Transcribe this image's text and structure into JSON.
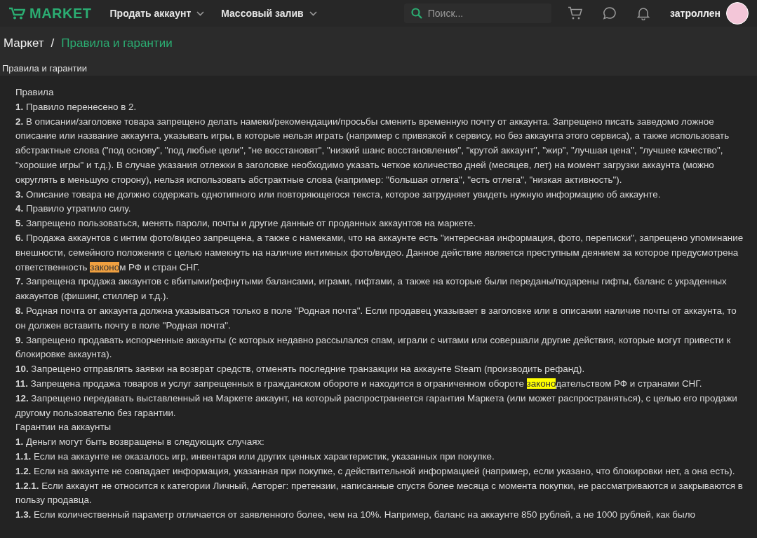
{
  "header": {
    "logo": "MARKET",
    "nav": [
      {
        "label": "Продать аккаунт"
      },
      {
        "label": "Массовый залив"
      }
    ],
    "search": {
      "placeholder": "Поиск..."
    },
    "username": "затроллен"
  },
  "breadcrumbs": [
    {
      "label": "Маркет",
      "selected": false
    },
    {
      "label": "Правила и гарантии",
      "selected": true
    }
  ],
  "breadcrumb_separator": "/",
  "page_title": "Правила и гарантии",
  "paragraphs": [
    {
      "kind": "heading",
      "segments": [
        {
          "text": "Правила",
          "highlighted": false
        }
      ]
    },
    {
      "kind": "item",
      "num": "1.",
      "segments": [
        {
          "text": "Правило перенесено в 2.",
          "highlighted": false
        }
      ]
    },
    {
      "kind": "item",
      "num": "2.",
      "segments": [
        {
          "text": "В описании/заголовке товара запрещено делать намеки/рекомендации/просьбы сменить временную почту от аккаунта. Запрещено писать заведомо ложное описание или название аккаунта, указывать игры, в которые нельзя играть (например с привязкой к сервису, но без аккаунта этого сервиса), а также использовать абстрактные слова (\"под основу\", \"под любые цели\", \"не восстановят\", \"низкий шанс восстановления\", \"крутой аккаунт\", \"жир\", \"лучшая цена\", \"лучшее качество\", \"хорошие игры\" и т.д.). В случае указания отлежки в заголовке необходимо указать четкое количество дней (месяцев, лет) на момент загрузки аккаунта (можно округлять в меньшую сторону), нельзя использовать абстрактные слова (например: \"большая отлега\", \"есть отлега\", \"низкая активность\").",
          "highlighted": false
        }
      ]
    },
    {
      "kind": "item",
      "num": "3.",
      "segments": [
        {
          "text": "Описание товара не должно содержать однотипного или повторяющегося текста, которое затрудняет увидеть нужную информацию об аккаунте.",
          "highlighted": false
        }
      ]
    },
    {
      "kind": "item",
      "num": "4.",
      "segments": [
        {
          "text": "Правило утратило силу.",
          "highlighted": false
        }
      ]
    },
    {
      "kind": "item",
      "num": "5.",
      "segments": [
        {
          "text": "Запрещено пользоваться, менять пароли, почты и другие данные от проданных аккаунтов на маркете.",
          "highlighted": false
        }
      ]
    },
    {
      "kind": "item",
      "num": "6.",
      "segments": [
        {
          "text": "Продажа аккаунтов с интим фото/видео запрещена, а также с намеками, что на аккаунте есть \"интересная информация, фото, переписки\", запрещено упоминание внешности, семейного положения с целью намекнуть на наличие интимных фото/видео. Данное действие является преступным деянием за которое предусмотрена ответственность ",
          "highlighted": false
        },
        {
          "text": "законо",
          "highlighted": true,
          "current": true
        },
        {
          "text": "м РФ и стран СНГ.",
          "highlighted": false
        }
      ]
    },
    {
      "kind": "item",
      "num": "7.",
      "segments": [
        {
          "text": "Запрещена продажа аккаунтов с вбитыми/рефнутыми балансами, играми, гифтами, а также на которые были переданы/подарены гифты, баланс с украденных аккаунтов (фишинг, стиллер и т.д.).",
          "highlighted": false
        }
      ]
    },
    {
      "kind": "item",
      "num": "8.",
      "segments": [
        {
          "text": "Родная почта от аккаунта должна указываться только в поле \"Родная почта\". Если продавец указывает в заголовке или в описании наличие почты от аккаунта, то он должен вставить почту в поле \"Родная почта\".",
          "highlighted": false
        }
      ]
    },
    {
      "kind": "item",
      "num": "9.",
      "segments": [
        {
          "text": "Запрещено продавать испорченные аккаунты (с которых недавно рассылался спам, играли с читами или совершали другие действия, которые могут привести к блокировке аккаунта).",
          "highlighted": false
        }
      ]
    },
    {
      "kind": "item",
      "num": "10.",
      "segments": [
        {
          "text": "Запрещено отправлять заявки на возврат средств, отменять последние транзакции на аккаунте Steam (производить рефанд).",
          "highlighted": false
        }
      ]
    },
    {
      "kind": "item",
      "num": "11.",
      "segments": [
        {
          "text": "Запрещена продажа товаров и услуг запрещенных в гражданском обороте и находится в ограниченном обороте ",
          "highlighted": false
        },
        {
          "text": "законо",
          "highlighted": true,
          "current": false
        },
        {
          "text": "дательством РФ и странами СНГ.",
          "highlighted": false
        }
      ]
    },
    {
      "kind": "item",
      "num": "12.",
      "segments": [
        {
          "text": "Запрещено передавать выставленный на Маркете аккаунт, на который распространяется гарантия Маркета (или может распространяться), с целью его продажи другому пользователю без гарантии.",
          "highlighted": false
        }
      ]
    },
    {
      "kind": "heading",
      "segments": [
        {
          "text": "Гарантии на аккаунты",
          "highlighted": false
        }
      ]
    },
    {
      "kind": "item",
      "num": "1.",
      "segments": [
        {
          "text": "Деньги могут быть возвращены в следующих случаях:",
          "highlighted": false
        }
      ]
    },
    {
      "kind": "item",
      "num": "1.1.",
      "segments": [
        {
          "text": "Если на аккаунте не оказалось игр, инвентаря или других ценных характеристик, указанных при покупке.",
          "highlighted": false
        }
      ]
    },
    {
      "kind": "item",
      "num": "1.2.",
      "segments": [
        {
          "text": "Если на аккаунте не совпадает информация, указанная при покупке, с действительной информацией (например, если указано, что блокировки нет, а она есть).",
          "highlighted": false
        }
      ]
    },
    {
      "kind": "item",
      "num": "1.2.1.",
      "segments": [
        {
          "text": "Если аккаунт не относится к категории Личный, Авторег: претензии, написанные спустя более месяца с момента покупки, не рассматриваются и закрываются в пользу продавца.",
          "highlighted": false
        }
      ]
    },
    {
      "kind": "item",
      "num": "1.3.",
      "segments": [
        {
          "text": "Если количественный параметр отличается от заявленного более, чем на 10%. Например, баланс на аккаунте 850 рублей, а не 1000 рублей, как было",
          "highlighted": false
        }
      ]
    }
  ]
}
